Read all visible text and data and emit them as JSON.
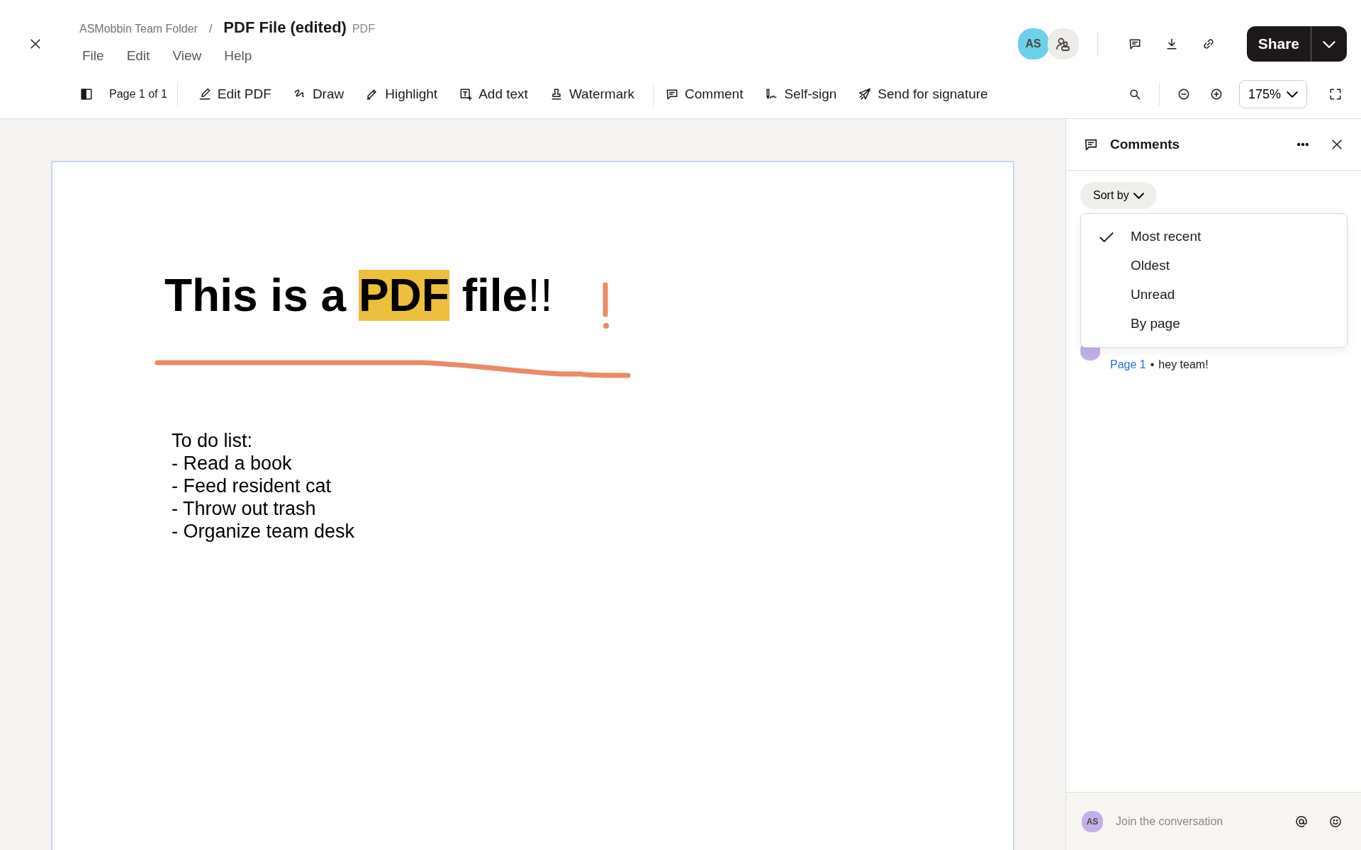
{
  "header": {
    "folder": "ASMobbin Team Folder",
    "separator": "/",
    "title": "PDF File (edited)",
    "file_type": "PDF",
    "menu": [
      "File",
      "Edit",
      "View",
      "Help"
    ],
    "avatar": {
      "initials": "AS",
      "color": "#6dd0ea"
    },
    "share_label": "Share"
  },
  "toolbar": {
    "page_indicator": "Page 1 of 1",
    "tools": [
      {
        "label": "Edit PDF"
      },
      {
        "label": "Draw"
      },
      {
        "label": "Highlight"
      },
      {
        "label": "Add text"
      },
      {
        "label": "Watermark"
      },
      {
        "label": "Comment",
        "divider_before": true
      },
      {
        "label": "Self-sign"
      },
      {
        "label": "Send for signature"
      }
    ],
    "zoom": "175%"
  },
  "document": {
    "heading": [
      {
        "text": "This is a ",
        "highlighted": false,
        "bold": true
      },
      {
        "text": "PDF",
        "highlighted": true,
        "bold": true
      },
      {
        "text": " file",
        "highlighted": false,
        "bold": true
      },
      {
        "text": "!!",
        "highlighted": false,
        "bold": false
      }
    ],
    "list": [
      "To do list:",
      "- Read a book",
      "- Feed resident cat",
      "- Throw out trash",
      "- Organize team desk"
    ]
  },
  "comments": {
    "title": "Comments",
    "sort_label": "Sort by",
    "sort_options": [
      {
        "label": "Most recent",
        "selected": true
      },
      {
        "label": "Oldest",
        "selected": false
      },
      {
        "label": "Unread",
        "selected": false
      },
      {
        "label": "By page",
        "selected": false
      }
    ],
    "items": [
      {
        "page_link": "Page 1",
        "separator": "•",
        "text": "hey team!"
      }
    ],
    "composer": {
      "initials": "AS",
      "placeholder": "Join the conversation"
    }
  }
}
